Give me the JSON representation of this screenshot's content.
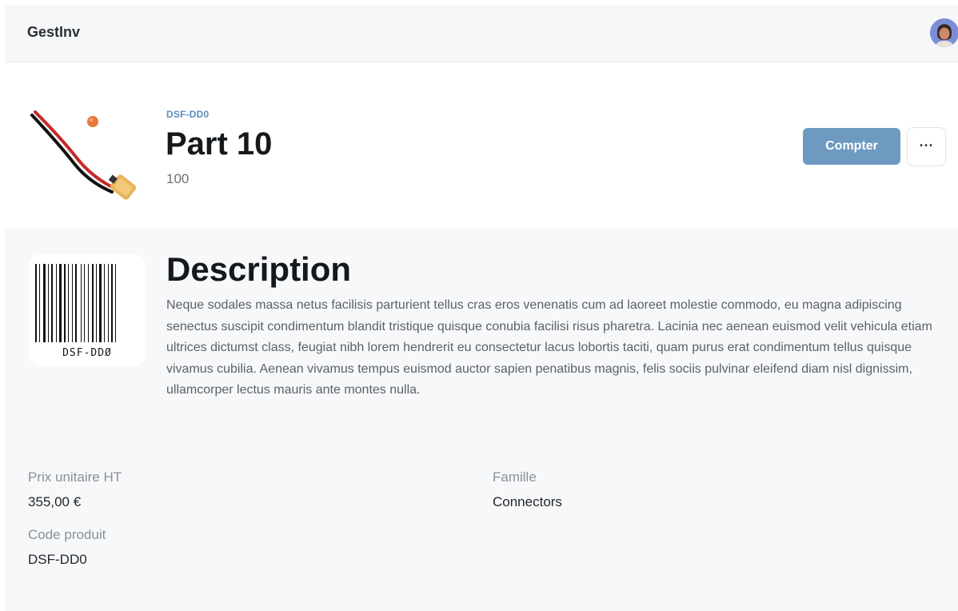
{
  "app": {
    "name": "GestInv"
  },
  "product": {
    "sku": "DSF-DD0",
    "name": "Part 10",
    "quantity": "100",
    "actions": {
      "count_label": "Compter",
      "more_label": "···"
    }
  },
  "barcode": {
    "text": "DSF-DDØ"
  },
  "description": {
    "heading": "Description",
    "body": "Neque sodales massa netus facilisis parturient tellus cras eros venenatis cum ad laoreet molestie commodo, eu magna adipiscing senectus suscipit condimentum blandit tristique quisque conubia facilisi risus pharetra. Lacinia nec aenean euismod velit vehicula etiam ultrices dictumst class, feugiat nibh lorem hendrerit eu consectetur lacus lobortis taciti, quam purus erat condimentum tellus quisque vivamus cubilia. Aenean vivamus tempus euismod auctor sapien penatibus magnis, felis sociis pulvinar eleifend diam nisl dignissim, ullamcorper lectus mauris ante montes nulla."
  },
  "fields": {
    "price": {
      "label": "Prix unitaire HT",
      "value": "355,00 €"
    },
    "family": {
      "label": "Famille",
      "value": "Connectors"
    },
    "code": {
      "label": "Code produit",
      "value": "DSF-DD0"
    }
  },
  "colors": {
    "accent": "#6e9ac1",
    "sku": "#5a8ec0",
    "panel": "#f7f8f9"
  }
}
